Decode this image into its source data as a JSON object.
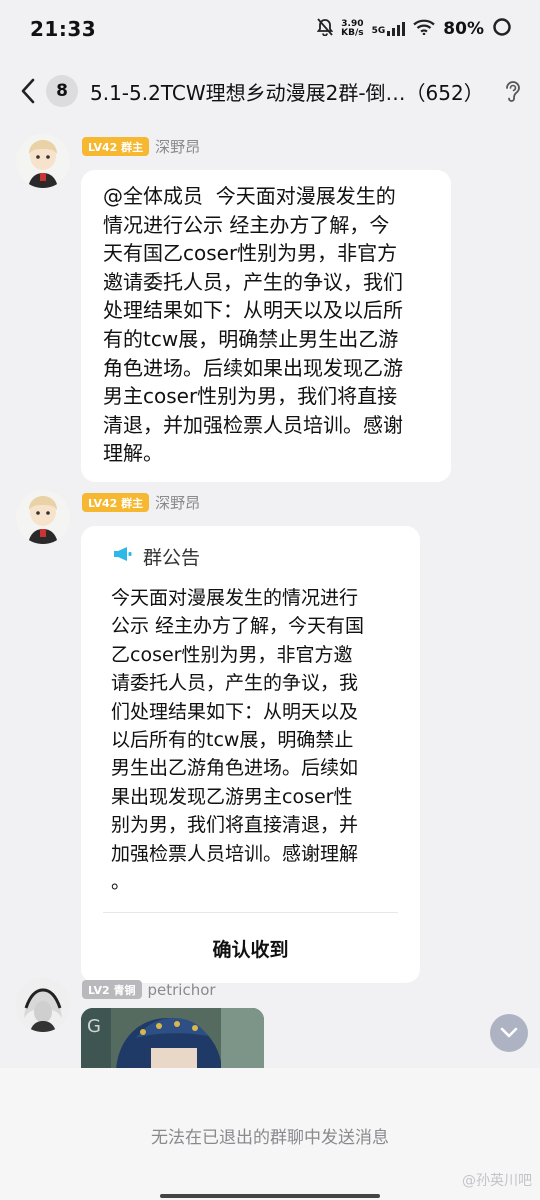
{
  "status_bar": {
    "time": "21:33",
    "net_speed_value": "3.90",
    "net_speed_unit": "KB/s",
    "network": "5G",
    "battery": "80%"
  },
  "header": {
    "back_icon": "chevron-left-icon",
    "unread_count": "8",
    "title": "5.1-5.2TCW理想乡动漫展2群-倒…（652）",
    "ear_icon": "ear-icon"
  },
  "messages": [
    {
      "level": "LV42 群主",
      "sender": "深野昂",
      "text": "@全体成员  今天面对漫展发生的\n情况进行公示 经主办方了解，今\n天有国乙coser性别为男，非官方\n邀请委托人员，产生的争议，我们\n处理结果如下：从明天以及以后所\n有的tcw展，明确禁止男生出乙游\n角色进场。后续如果出现发现乙游\n男主coser性别为男，我们将直接\n清退，并加强检票人员培训。感谢\n理解。"
    },
    {
      "level": "LV42 群主",
      "sender": "深野昂",
      "notice_title": "群公告",
      "notice_text": "今天面对漫展发生的情况进行\n公示 经主办方了解，今天有国\n乙coser性别为男，非官方邀\n请委托人员，产生的争议，我\n们处理结果如下：从明天以及\n以后所有的tcw展，明确禁止\n男生出乙游角色进场。后续如\n果出现发现乙游男主coser性\n别为男，我们将直接清退，并\n加强检票人员培训。感谢理解\n。",
      "confirm_label": "确认收到"
    },
    {
      "level": "LV2 青铜",
      "sender": "petrichor"
    }
  ],
  "bottom": {
    "exit_notice": "无法在已退出的群聊中发送消息"
  },
  "watermark": "@孙英川吧",
  "colors": {
    "owner_badge": "#f6b731",
    "bronze_badge": "#b9b9bd",
    "notice_accent": "#2fb7e8"
  }
}
